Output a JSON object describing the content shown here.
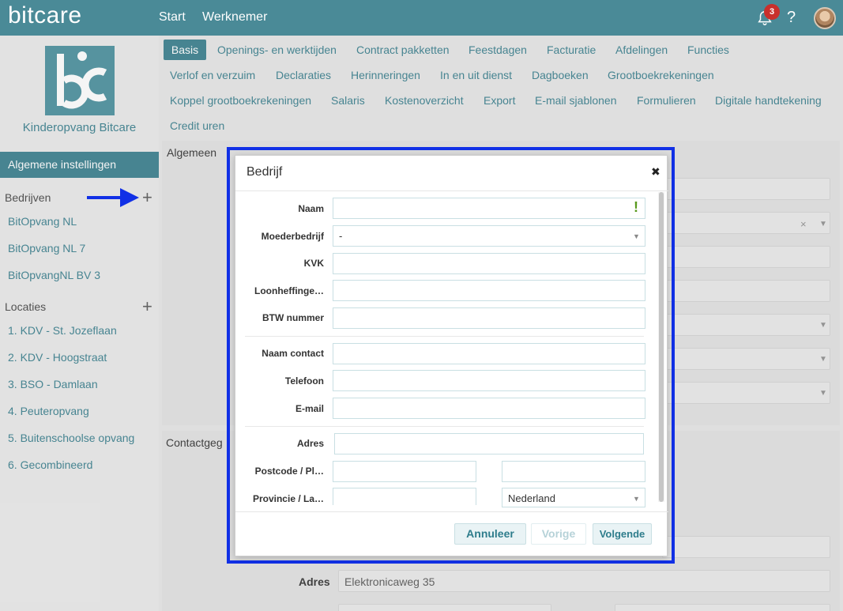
{
  "topbar": {
    "brand": "bitcare",
    "nav": [
      "Start",
      "Werknemer"
    ],
    "notifications": "3",
    "help": "?"
  },
  "sidebar": {
    "org_name": "Kinderopvang Bitcare",
    "active_item": "Algemene instellingen",
    "companies_title": "Bedrijven",
    "companies": [
      "BitOpvang NL",
      "BitOpvang NL 7",
      "BitOpvangNL BV 3"
    ],
    "locations_title": "Locaties",
    "locations": [
      "1. KDV - St. Jozeflaan",
      "2. KDV - Hoogstraat",
      "3. BSO - Damlaan",
      "4. Peuteropvang",
      "5. Buitenschoolse opvang",
      "6. Gecombineerd"
    ],
    "plus": "+"
  },
  "tabs": {
    "active": "Basis",
    "row1": [
      "Openings- en werktijden",
      "Contract pakketten",
      "Feestdagen",
      "Facturatie",
      "Afdelingen",
      "Functies"
    ],
    "row2": [
      "Verlof en verzuim",
      "Declaraties",
      "Herinneringen",
      "In en uit dienst",
      "Dagboeken",
      "Grootboekrekeningen"
    ],
    "row3": [
      "Koppel grootboekrekeningen",
      "Salaris",
      "Kostenoverzicht",
      "Export",
      "E-mail sjablonen",
      "Formulieren",
      "Digitale handtekening"
    ],
    "row4": [
      "Credit uren"
    ]
  },
  "background": {
    "section_general": "Algemeen",
    "section_contact": "Contactgeg",
    "address_label": "Adres",
    "address_value": "Elektronicaweg 35",
    "clear": "×"
  },
  "modal": {
    "title": "Bedrijf",
    "close": "✖",
    "fields": {
      "naam": "Naam",
      "moederbedrijf": "Moederbedrijf",
      "moederbedrijf_value": "-",
      "kvk": "KVK",
      "loonheffing": "Loonheffinge…",
      "btw": "BTW nummer",
      "naam_contact": "Naam contact",
      "telefoon": "Telefoon",
      "email": "E-mail",
      "adres": "Adres",
      "postcode": "Postcode / Pl…",
      "provincie": "Provincie / La…",
      "land_value": "Nederland"
    },
    "warn": "!",
    "buttons": {
      "cancel": "Annuleer",
      "prev": "Vorige",
      "next": "Volgende"
    }
  }
}
